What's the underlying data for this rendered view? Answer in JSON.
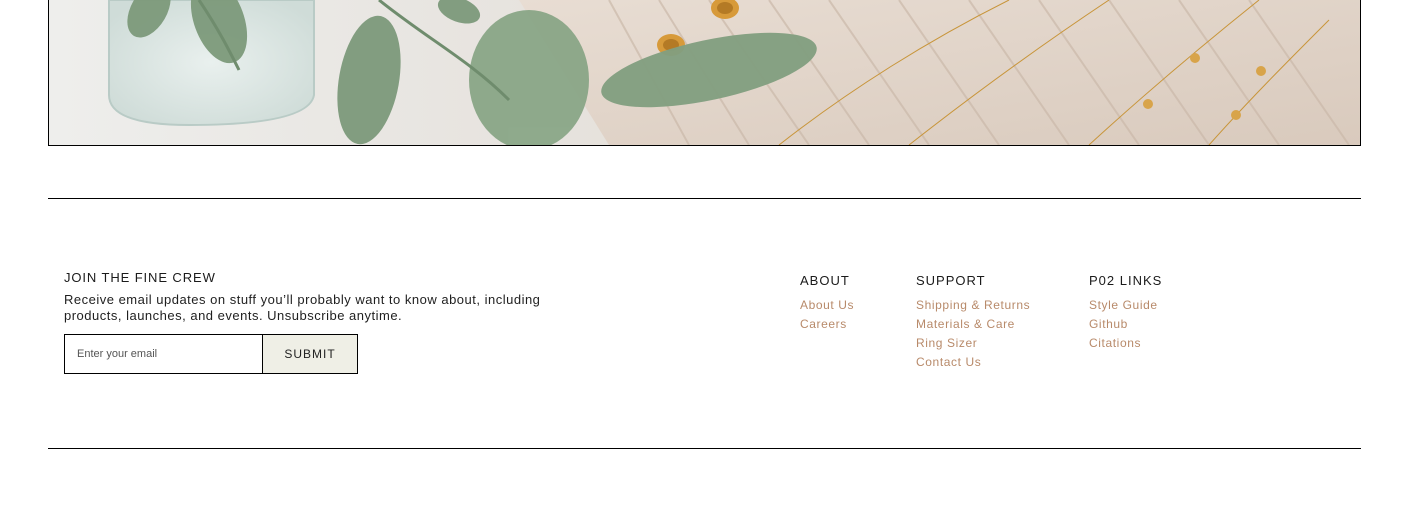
{
  "hero": {
    "image_description_icon": "jewelry-photo"
  },
  "newsletter": {
    "title": "JOIN THE FINE CREW",
    "description": "Receive email updates on stuff you’ll probably want to know about, including products, launches, and events. Unsubscribe anytime.",
    "email_placeholder": "Enter your email",
    "submit_label": "SUBMIT"
  },
  "footer": {
    "columns": [
      {
        "heading": "ABOUT",
        "links": [
          "About Us",
          "Careers"
        ]
      },
      {
        "heading": "SUPPORT",
        "links": [
          "Shipping & Returns",
          "Materials & Care",
          "Ring Sizer",
          "Contact Us"
        ]
      },
      {
        "heading": "P02 LINKS",
        "links": [
          "Style Guide",
          "Github",
          "Citations"
        ]
      }
    ]
  },
  "colors": {
    "link": "#b88a6a",
    "submit_bg": "#efefe6",
    "border": "#000000"
  }
}
